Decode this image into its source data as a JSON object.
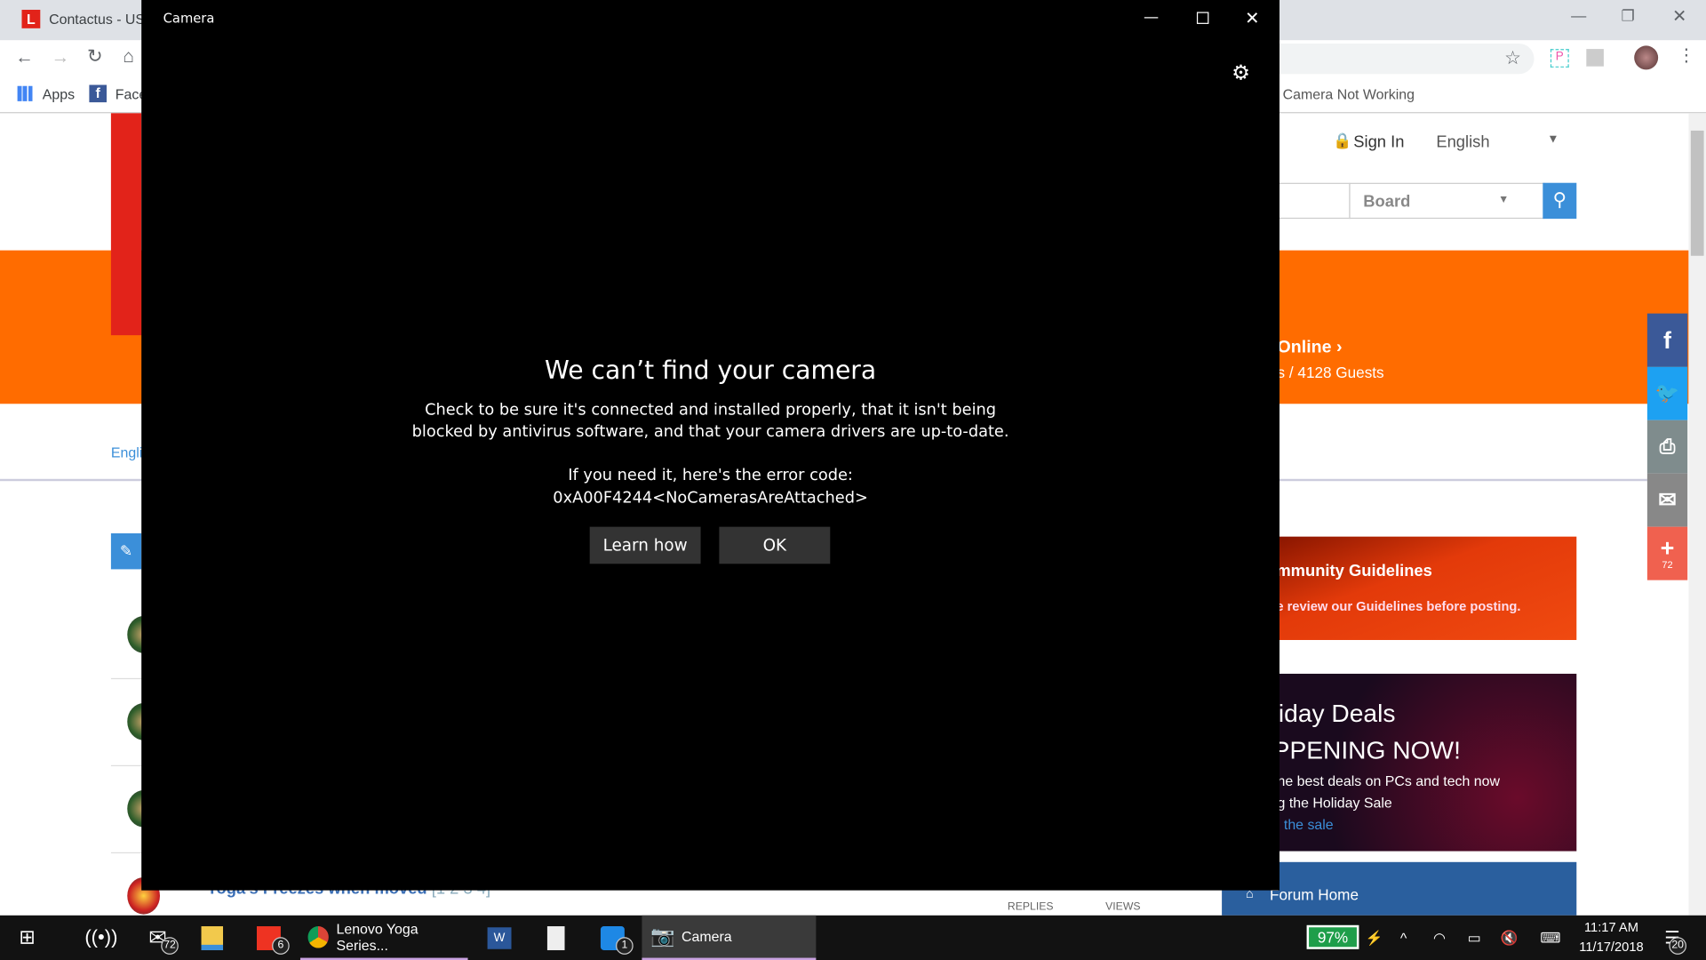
{
  "browser": {
    "tab_title": "Contactus - US",
    "bookmarks": {
      "apps": "Apps",
      "facebook": "Face",
      "right_item": "Camera Not Working"
    }
  },
  "page": {
    "sign_in": "Sign In",
    "language": "English",
    "search_scope": "Board",
    "online_title": "Online",
    "online_stats": "s / 4128 Guests",
    "language_link": "Engli",
    "topic_title": "Yoga's Freezes when moved",
    "topic_pages": "[1 2 3 4]",
    "replies_label": "REPLIES",
    "views_label": "VIEWS",
    "guidelines_title": "mmunity Guidelines",
    "guidelines_text": "e review our Guidelines before posting.",
    "deals_line1": "liday Deals",
    "deals_line2": "PPENING NOW!",
    "deals_line3": "he best deals on PCs and tech now",
    "deals_line4": "g the Holiday Sale",
    "deals_link": "the sale",
    "forum_home": "Forum Home",
    "share_count": "72"
  },
  "camera": {
    "window_title": "Camera",
    "error_title": "We can’t find your camera",
    "error_line1": "Check to be sure it's connected and installed properly, that it isn't being",
    "error_line2": "blocked by antivirus software, and that your camera drivers are up-to-date.",
    "code_intro": "If you need it, here's the error code:",
    "code": "0xA00F4244<NoCamerasAreAttached>",
    "learn_how": "Learn how",
    "ok": "OK"
  },
  "taskbar": {
    "mail_badge": "72",
    "app_badge": "6",
    "chrome_label": "Lenovo Yoga Series...",
    "messenger_badge": "1",
    "camera_label": "Camera",
    "battery": "97%",
    "time": "11:17 AM",
    "date": "11/17/2018",
    "notifications": "20"
  },
  "colors": {
    "orange": "#ff6c00",
    "lenovo_red": "#e2231a",
    "blue": "#3b8fd9",
    "battery_green": "#1e9e4a"
  }
}
